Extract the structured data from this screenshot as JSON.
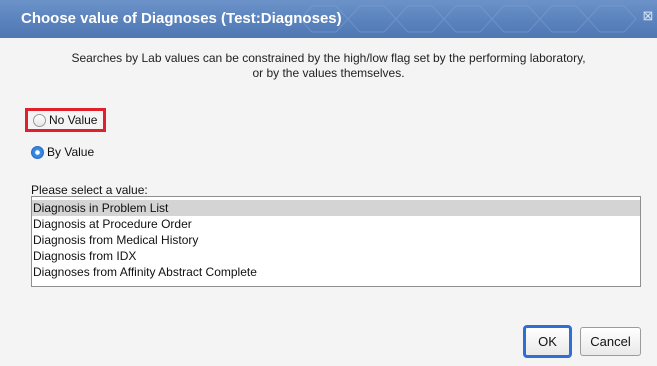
{
  "dialog": {
    "title": "Choose value of Diagnoses (Test:Diagnoses)",
    "close_glyph": "⊠",
    "intro_line1": "Searches by Lab values can be constrained by the high/low flag set by the performing laboratory,",
    "intro_line2": "or by the values themselves."
  },
  "options": {
    "no_value_label": "No Value",
    "by_value_label": "By Value",
    "selected": "By Value"
  },
  "value_list": {
    "label": "Please select a value:",
    "items": [
      "Diagnosis in Problem List",
      "Diagnosis at Procedure Order",
      "Diagnosis from Medical History",
      "Diagnosis from IDX",
      "Diagnoses from Affinity Abstract Complete"
    ],
    "selected_index": 0
  },
  "buttons": {
    "ok_label": "OK",
    "cancel_label": "Cancel"
  },
  "colors": {
    "titlebar": "#5a82bc",
    "highlight_border": "#e0212b",
    "ok_border": "#2f6fd3",
    "selected_row": "#d4d4d4"
  }
}
